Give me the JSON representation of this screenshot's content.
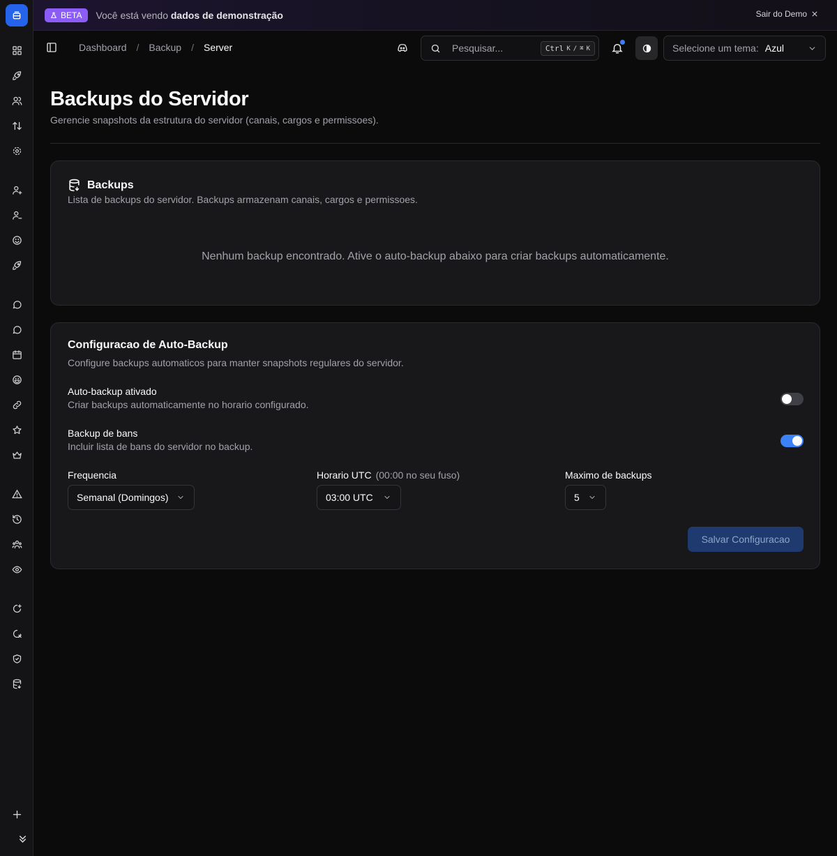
{
  "banner": {
    "badge": "BETA",
    "text_prefix": "Você está vendo ",
    "text_bold": "dados de demonstração",
    "exit_label": "Sair do Demo"
  },
  "breadcrumb": [
    "Dashboard",
    "Backup",
    "Server"
  ],
  "search": {
    "placeholder": "Pesquisar...",
    "shortcut_ctrl": "Ctrl",
    "shortcut_k": "K",
    "shortcut_sep": "/",
    "shortcut_cmd": "⌘",
    "shortcut_k2": "K"
  },
  "theme": {
    "label": "Selecione um tema:",
    "value": "Azul"
  },
  "page": {
    "title": "Backups do Servidor",
    "subtitle": "Gerencie snapshots da estrutura do servidor (canais, cargos e permissoes)."
  },
  "backups_card": {
    "title": "Backups",
    "description": "Lista de backups do servidor. Backups armazenam canais, cargos e permissoes.",
    "empty_message": "Nenhum backup encontrado. Ative o auto-backup abaixo para criar backups automaticamente."
  },
  "auto_backup": {
    "title": "Configuracao de Auto-Backup",
    "description": "Configure backups automaticos para manter snapshots regulares do servidor.",
    "enabled": {
      "label": "Auto-backup ativado",
      "help": "Criar backups automaticamente no horario configurado.",
      "value": false
    },
    "bans": {
      "label": "Backup de bans",
      "help": "Incluir lista de bans do servidor no backup.",
      "value": true
    },
    "frequency": {
      "label": "Frequencia",
      "value": "Semanal (Domingos)"
    },
    "time": {
      "label": "Horario UTC",
      "hint": "(00:00 no seu fuso)",
      "value": "03:00 UTC"
    },
    "max": {
      "label": "Maximo de backups",
      "value": "5"
    },
    "save_label": "Salvar Configuracao"
  },
  "colors": {
    "accent": "#2563eb",
    "beta": "#8b5cf6",
    "toggle_on": "#3b82f6",
    "background": "#0b0b0c",
    "card": "#18181b"
  },
  "sidebar_icons": [
    "dashboard-icon",
    "rocket-icon",
    "users-icon",
    "sort-icon",
    "settings-icon",
    "user-plus-icon",
    "user-minus-icon",
    "smile-icon",
    "rocket-icon",
    "message-icon",
    "message-icon",
    "calendar-icon",
    "emoji-icon",
    "link-icon",
    "star-icon",
    "crown-icon",
    "warning-icon",
    "history-icon",
    "group-icon",
    "eye-icon",
    "shield-plus-icon",
    "shield-x-icon",
    "shield-check-icon",
    "database-icon",
    "plus-icon",
    "chevrons-down-icon"
  ]
}
